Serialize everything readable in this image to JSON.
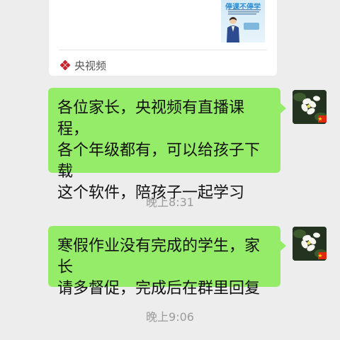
{
  "shared_card": {
    "thumb_title": "停课不停学",
    "source_label": "央视频"
  },
  "messages": [
    {
      "lines": [
        "各位家长，央视频有直播课程，",
        "各个年级都有，可以给孩子下载",
        "这个软件，陪孩子一起学习"
      ]
    },
    {
      "lines": [
        "寒假作业没有完成的学生，家长",
        "请多督促，完成后在群里回复"
      ]
    }
  ],
  "timestamps": [
    "晚上8:31",
    "晚上9:06"
  ],
  "colors": {
    "bubble": "#95ec69",
    "background": "#ededed",
    "timestamp": "#9b9b9b"
  }
}
